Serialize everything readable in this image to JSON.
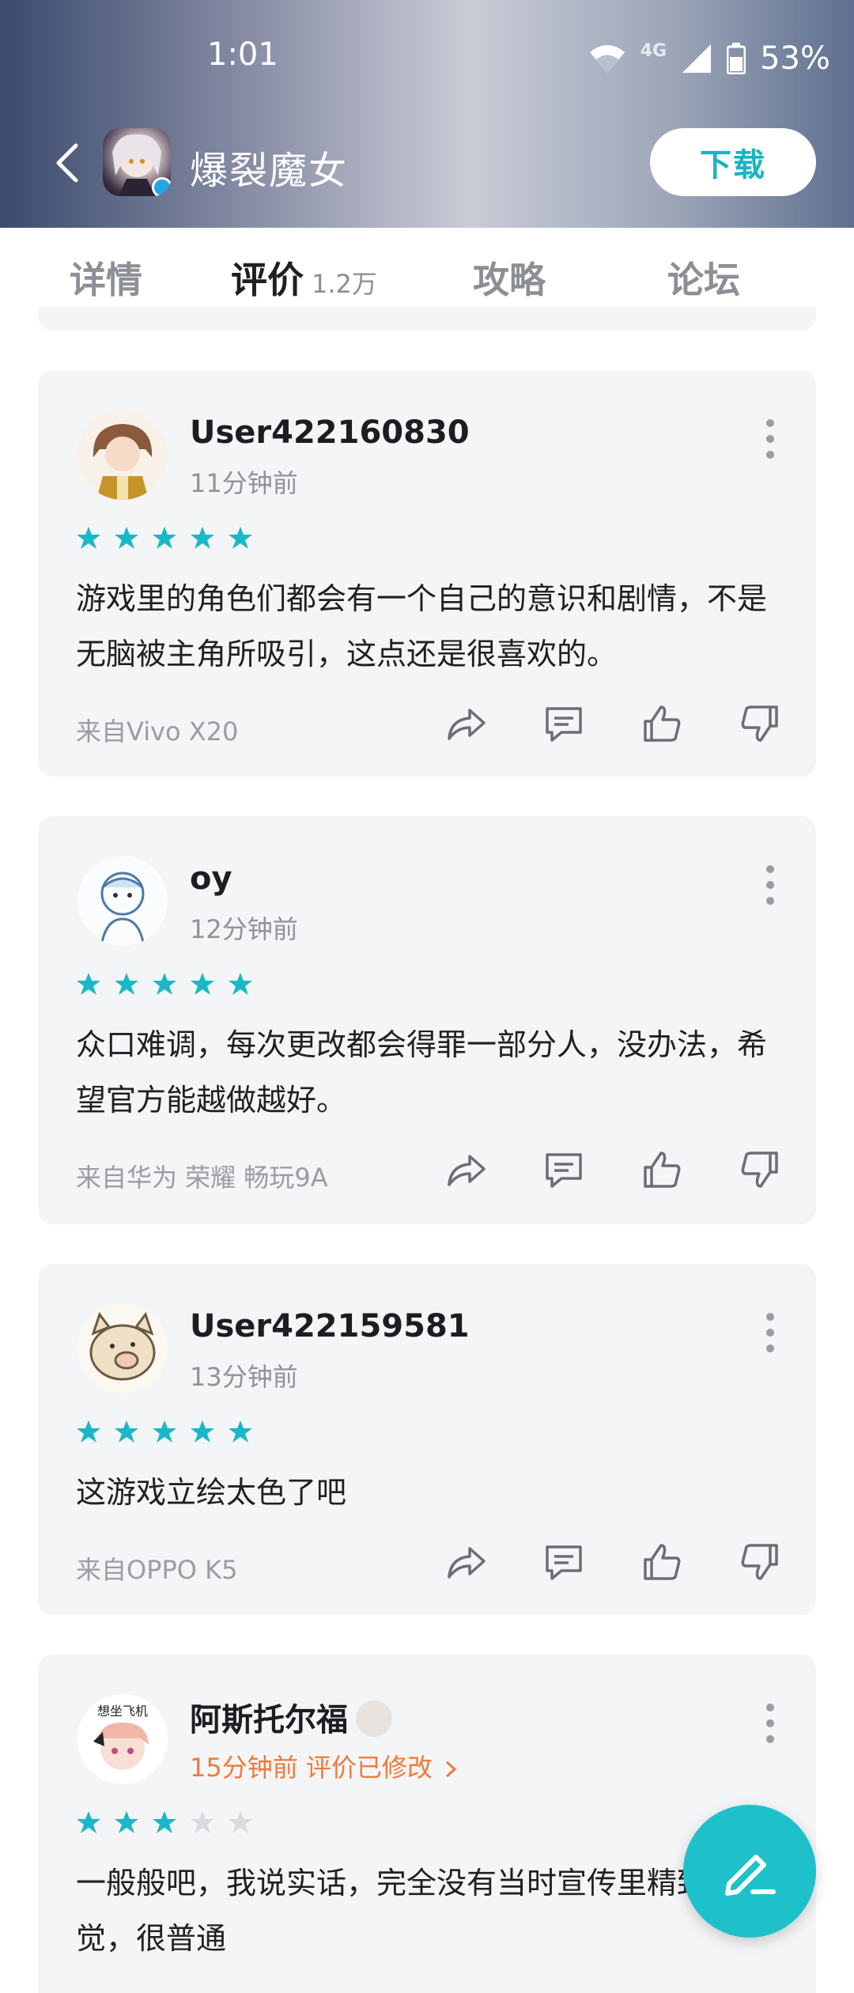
{
  "status": {
    "time": "1:01",
    "network": "4G",
    "battery": "53%"
  },
  "app": {
    "name": "爆裂魔女",
    "download_label": "下载"
  },
  "tabs": [
    {
      "label": "详情"
    },
    {
      "label": "评价",
      "count": "1.2万"
    },
    {
      "label": "攻略"
    },
    {
      "label": "论坛"
    }
  ],
  "reviews": [
    {
      "user": "User422160830",
      "time": "11分钟前",
      "rating": 5,
      "text": "游戏里的角色们都会有一个自己的意识和剧情，不是无脑被主角所吸引，这点还是很喜欢的。",
      "device": "来自Vivo X20"
    },
    {
      "user": "oy",
      "time": "12分钟前",
      "rating": 5,
      "text": "众口难调，每次更改都会得罪一部分人，没办法，希望官方能越做越好。",
      "device": "来自华为 荣耀 畅玩9A"
    },
    {
      "user": "User422159581",
      "time": "13分钟前",
      "rating": 5,
      "text": "这游戏立绘太色了吧",
      "device": "来自OPPO K5"
    },
    {
      "user": "阿斯托尔福",
      "time": "15分钟前 评价已修改",
      "rating": 3,
      "text": "一般般吧，我说实话，完全没有当时宣传里精致的感觉，很普通",
      "avatar_text": "想坐飞机"
    }
  ],
  "colors": {
    "accent": "#19b8c7",
    "star_on": "#19b8c7",
    "star_off": "#d9dadd",
    "edited": "#f07a3a"
  },
  "icons": [
    "back-icon",
    "share-icon",
    "comment-icon",
    "thumbs-up-icon",
    "thumbs-down-icon",
    "more-icon",
    "edit-icon"
  ]
}
